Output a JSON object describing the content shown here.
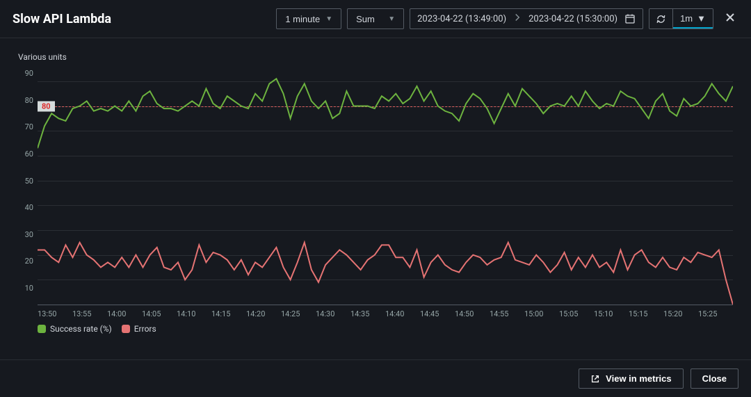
{
  "title": "Slow API Lambda",
  "controls": {
    "period": "1 minute",
    "statistic": "Sum",
    "range_start": "2023-04-22 (13:49:00)",
    "range_end": "2023-04-22 (15:30:00)",
    "refresh_interval": "1m"
  },
  "chart": {
    "y_title": "Various units",
    "threshold": 80,
    "threshold_label": "80",
    "y_ticks": [
      "90",
      "80",
      "70",
      "60",
      "50",
      "40",
      "30",
      "20",
      "10"
    ],
    "x_ticks": [
      "13:50",
      "13:55",
      "14:00",
      "14:05",
      "14:10",
      "14:15",
      "14:20",
      "14:25",
      "14:30",
      "14:35",
      "14:40",
      "14:45",
      "14:50",
      "14:55",
      "15:00",
      "15:05",
      "15:10",
      "15:15",
      "15:20",
      "15:25"
    ],
    "legend": [
      {
        "label": "Success rate (%)",
        "color": "#6db33f"
      },
      {
        "label": "Errors",
        "color": "#e57373"
      }
    ]
  },
  "footer": {
    "view_metrics": "View in metrics",
    "close": "Close"
  },
  "colors": {
    "success": "#6db33f",
    "errors": "#e57373",
    "threshold": "#e06060"
  },
  "chart_data": {
    "type": "line",
    "title": "Slow API Lambda",
    "ylabel": "Various units",
    "xlabel": "",
    "ylim": [
      0,
      95
    ],
    "threshold": 80,
    "x": [
      "13:49",
      "13:50",
      "13:51",
      "13:52",
      "13:53",
      "13:54",
      "13:55",
      "13:56",
      "13:57",
      "13:58",
      "13:59",
      "14:00",
      "14:01",
      "14:02",
      "14:03",
      "14:04",
      "14:05",
      "14:06",
      "14:07",
      "14:08",
      "14:09",
      "14:10",
      "14:11",
      "14:12",
      "14:13",
      "14:14",
      "14:15",
      "14:16",
      "14:17",
      "14:18",
      "14:19",
      "14:20",
      "14:21",
      "14:22",
      "14:23",
      "14:24",
      "14:25",
      "14:26",
      "14:27",
      "14:28",
      "14:29",
      "14:30",
      "14:31",
      "14:32",
      "14:33",
      "14:34",
      "14:35",
      "14:36",
      "14:37",
      "14:38",
      "14:39",
      "14:40",
      "14:41",
      "14:42",
      "14:43",
      "14:44",
      "14:45",
      "14:46",
      "14:47",
      "14:48",
      "14:49",
      "14:50",
      "14:51",
      "14:52",
      "14:53",
      "14:54",
      "14:55",
      "14:56",
      "14:57",
      "14:58",
      "14:59",
      "15:00",
      "15:01",
      "15:02",
      "15:03",
      "15:04",
      "15:05",
      "15:06",
      "15:07",
      "15:08",
      "15:09",
      "15:10",
      "15:11",
      "15:12",
      "15:13",
      "15:14",
      "15:15",
      "15:16",
      "15:17",
      "15:18",
      "15:19",
      "15:20",
      "15:21",
      "15:22",
      "15:23",
      "15:24",
      "15:25",
      "15:26",
      "15:27",
      "15:28"
    ],
    "series": [
      {
        "name": "Success rate (%)",
        "color": "#6db33f",
        "values": [
          63,
          72,
          77,
          75,
          74,
          79,
          80,
          82,
          78,
          79,
          78,
          80,
          78,
          82,
          78,
          84,
          86,
          81,
          79,
          79,
          78,
          80,
          82,
          80,
          87,
          81,
          79,
          84,
          82,
          80,
          79,
          85,
          82,
          89,
          91,
          85,
          75,
          84,
          89,
          82,
          79,
          82,
          75,
          77,
          86,
          80,
          80,
          80,
          79,
          84,
          82,
          85,
          81,
          83,
          88,
          82,
          86,
          80,
          78,
          77,
          74,
          81,
          85,
          83,
          79,
          73,
          79,
          85,
          80,
          87,
          84,
          81,
          77,
          80,
          81,
          80,
          84,
          80,
          86,
          82,
          79,
          81,
          80,
          86,
          84,
          83,
          79,
          75,
          82,
          85,
          78,
          76,
          83,
          80,
          81,
          84,
          89,
          85,
          82,
          88
        ]
      },
      {
        "name": "Errors",
        "color": "#e57373",
        "values": [
          22,
          22,
          19,
          17,
          24,
          19,
          25,
          20,
          18,
          15,
          17,
          15,
          19,
          15,
          20,
          15,
          20,
          23,
          15,
          14,
          17,
          10,
          14,
          24,
          17,
          21,
          20,
          18,
          14,
          18,
          12,
          17,
          15,
          19,
          23,
          15,
          10,
          17,
          25,
          14,
          9,
          16,
          19,
          22,
          20,
          17,
          14,
          18,
          20,
          24,
          24,
          19,
          19,
          15,
          22,
          11,
          17,
          20,
          16,
          14,
          13,
          17,
          20,
          19,
          16,
          18,
          19,
          25,
          18,
          17,
          16,
          20,
          17,
          13,
          16,
          21,
          14,
          19,
          15,
          20,
          15,
          17,
          13,
          22,
          14,
          20,
          22,
          17,
          15,
          19,
          15,
          14,
          19,
          17,
          21,
          20,
          19,
          22,
          10,
          0
        ]
      }
    ]
  }
}
